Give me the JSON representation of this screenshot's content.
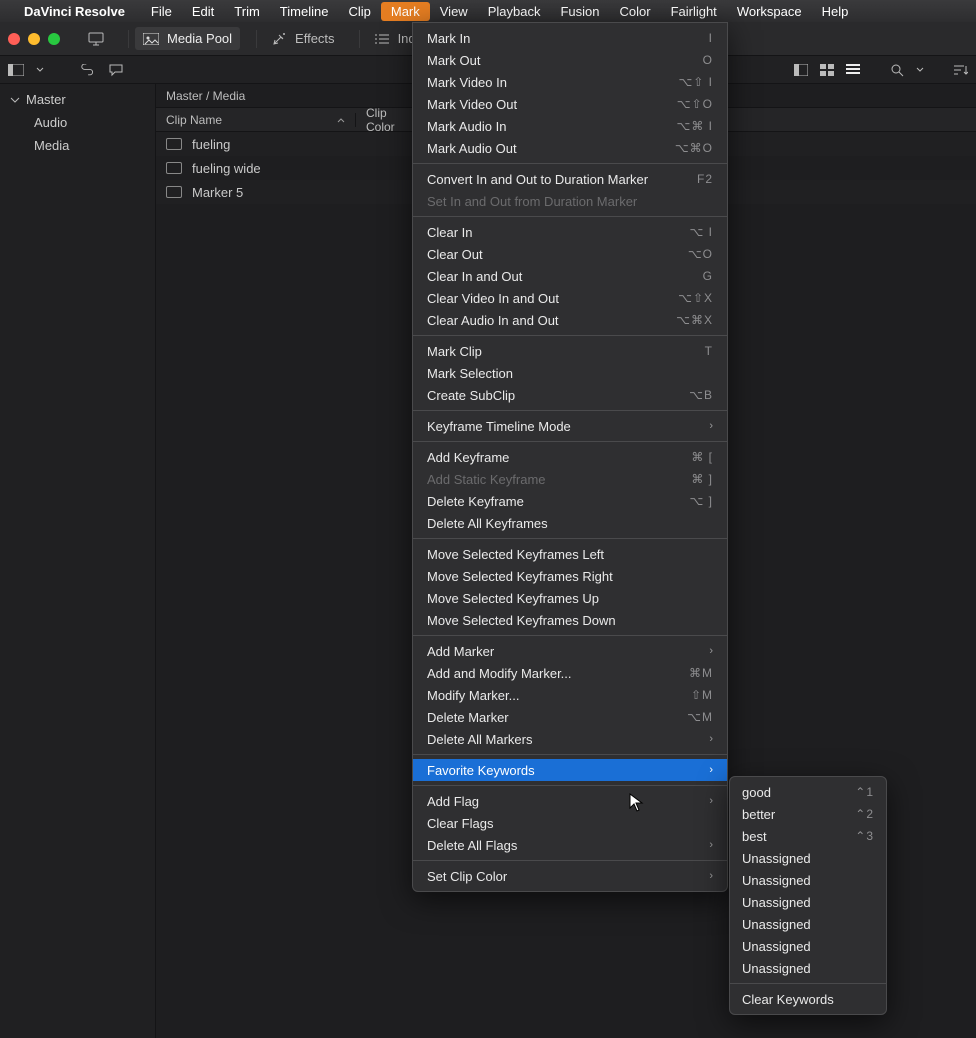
{
  "menubar": {
    "app": "DaVinci Resolve",
    "items": [
      "File",
      "Edit",
      "Trim",
      "Timeline",
      "Clip",
      "Mark",
      "View",
      "Playback",
      "Fusion",
      "Color",
      "Fairlight",
      "Workspace",
      "Help"
    ],
    "active": "Mark"
  },
  "toolbar": {
    "media_pool": "Media Pool",
    "effects": "Effects",
    "index": "Index"
  },
  "sidebar": {
    "root": "Master",
    "items": [
      "Audio",
      "Media"
    ]
  },
  "content": {
    "breadcrumb": "Master / Media",
    "col1": "Clip Name",
    "col2": "Clip Color",
    "clips": [
      "fueling",
      "fueling wide",
      "Marker 5"
    ]
  },
  "mark_menu": [
    {
      "t": "item",
      "label": "Mark In",
      "sc": "I"
    },
    {
      "t": "item",
      "label": "Mark Out",
      "sc": "O"
    },
    {
      "t": "item",
      "label": "Mark Video In",
      "sc": "⌥⇧ I"
    },
    {
      "t": "item",
      "label": "Mark Video Out",
      "sc": "⌥⇧O"
    },
    {
      "t": "item",
      "label": "Mark Audio In",
      "sc": "⌥⌘ I"
    },
    {
      "t": "item",
      "label": "Mark Audio Out",
      "sc": "⌥⌘O"
    },
    {
      "t": "sep"
    },
    {
      "t": "item",
      "label": "Convert In and Out to Duration Marker",
      "sc": "F2"
    },
    {
      "t": "item",
      "label": "Set In and Out from Duration Marker",
      "disabled": true
    },
    {
      "t": "sep"
    },
    {
      "t": "item",
      "label": "Clear In",
      "sc": "⌥ I"
    },
    {
      "t": "item",
      "label": "Clear Out",
      "sc": "⌥O"
    },
    {
      "t": "item",
      "label": "Clear In and Out",
      "sc": "G"
    },
    {
      "t": "item",
      "label": "Clear Video In and Out",
      "sc": "⌥⇧X"
    },
    {
      "t": "item",
      "label": "Clear Audio In and Out",
      "sc": "⌥⌘X"
    },
    {
      "t": "sep"
    },
    {
      "t": "item",
      "label": "Mark Clip",
      "sc": "T"
    },
    {
      "t": "item",
      "label": "Mark Selection"
    },
    {
      "t": "item",
      "label": "Create SubClip",
      "sc": "⌥B"
    },
    {
      "t": "sep"
    },
    {
      "t": "item",
      "label": "Keyframe Timeline Mode",
      "sub": true
    },
    {
      "t": "sep"
    },
    {
      "t": "item",
      "label": "Add Keyframe",
      "sc": "⌘ ["
    },
    {
      "t": "item",
      "label": "Add Static Keyframe",
      "sc": "⌘ ]",
      "disabled": true
    },
    {
      "t": "item",
      "label": "Delete Keyframe",
      "sc": "⌥ ]"
    },
    {
      "t": "item",
      "label": "Delete All Keyframes"
    },
    {
      "t": "sep"
    },
    {
      "t": "item",
      "label": "Move Selected Keyframes Left"
    },
    {
      "t": "item",
      "label": "Move Selected Keyframes Right"
    },
    {
      "t": "item",
      "label": "Move Selected Keyframes Up"
    },
    {
      "t": "item",
      "label": "Move Selected Keyframes Down"
    },
    {
      "t": "sep"
    },
    {
      "t": "item",
      "label": "Add Marker",
      "sub": true
    },
    {
      "t": "item",
      "label": "Add and Modify Marker...",
      "sc": "⌘M"
    },
    {
      "t": "item",
      "label": "Modify Marker...",
      "sc": "⇧M"
    },
    {
      "t": "item",
      "label": "Delete Marker",
      "sc": "⌥M"
    },
    {
      "t": "item",
      "label": "Delete All Markers",
      "sub": true
    },
    {
      "t": "sep"
    },
    {
      "t": "item",
      "label": "Favorite Keywords",
      "sub": true,
      "hl": true
    },
    {
      "t": "sep"
    },
    {
      "t": "item",
      "label": "Add Flag",
      "sub": true
    },
    {
      "t": "item",
      "label": "Clear Flags"
    },
    {
      "t": "item",
      "label": "Delete All Flags",
      "sub": true
    },
    {
      "t": "sep"
    },
    {
      "t": "item",
      "label": "Set Clip Color",
      "sub": true
    }
  ],
  "submenu": [
    {
      "t": "item",
      "label": "good",
      "sc": "⌃1"
    },
    {
      "t": "item",
      "label": "better",
      "sc": "⌃2"
    },
    {
      "t": "item",
      "label": "best",
      "sc": "⌃3"
    },
    {
      "t": "item",
      "label": "Unassigned"
    },
    {
      "t": "item",
      "label": "Unassigned"
    },
    {
      "t": "item",
      "label": "Unassigned"
    },
    {
      "t": "item",
      "label": "Unassigned"
    },
    {
      "t": "item",
      "label": "Unassigned"
    },
    {
      "t": "item",
      "label": "Unassigned"
    },
    {
      "t": "sep"
    },
    {
      "t": "item",
      "label": "Clear Keywords"
    }
  ]
}
